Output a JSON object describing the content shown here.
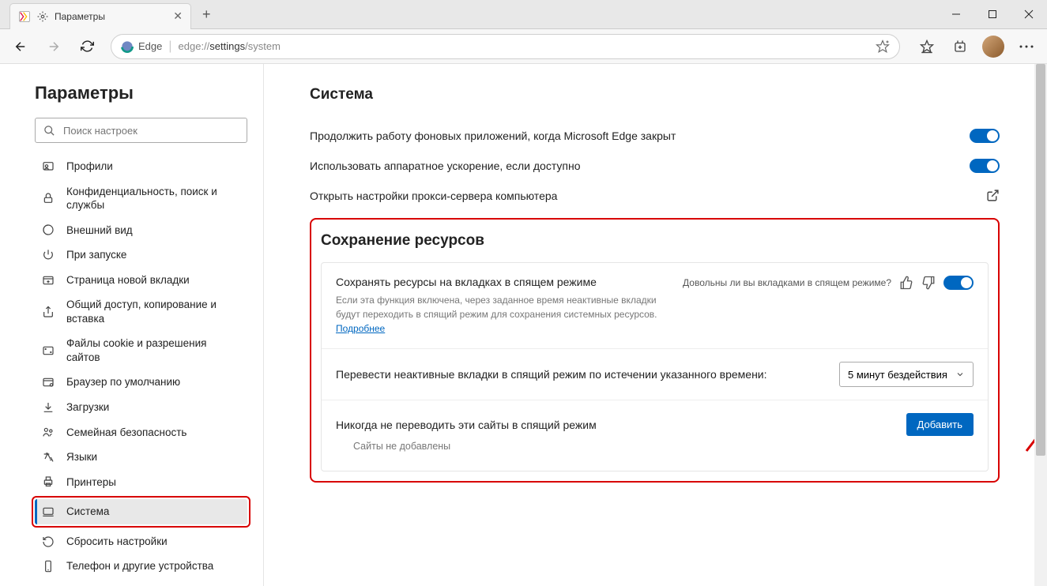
{
  "tab": {
    "title": "Параметры"
  },
  "address": {
    "scheme": "edge://",
    "path_dark": "settings",
    "path_rest": "/system",
    "edge_label": "Edge"
  },
  "sidebar": {
    "title": "Параметры",
    "search_placeholder": "Поиск настроек",
    "items": [
      {
        "label": "Профили"
      },
      {
        "label": "Конфиденциальность, поиск и службы"
      },
      {
        "label": "Внешний вид"
      },
      {
        "label": "При запуске"
      },
      {
        "label": "Страница новой вкладки"
      },
      {
        "label": "Общий доступ, копирование и вставка"
      },
      {
        "label": "Файлы cookie и разрешения сайтов"
      },
      {
        "label": "Браузер по умолчанию"
      },
      {
        "label": "Загрузки"
      },
      {
        "label": "Семейная безопасность"
      },
      {
        "label": "Языки"
      },
      {
        "label": "Принтеры"
      },
      {
        "label": "Система"
      },
      {
        "label": "Сбросить настройки"
      },
      {
        "label": "Телефон и другие устройства"
      }
    ]
  },
  "content": {
    "section1_title": "Система",
    "row1": "Продолжить работу фоновых приложений, когда Microsoft Edge закрыт",
    "row2": "Использовать аппаратное ускорение, если доступно",
    "row3": "Открыть настройки прокси-сервера компьютера",
    "section2_title": "Сохранение ресурсов",
    "sleep_card": {
      "title": "Сохранять ресурсы на вкладках в спящем режиме",
      "desc": "Если эта функция включена, через заданное время неактивные вкладки будут переходить в спящий режим для сохранения системных ресурсов. ",
      "link": "Подробнее",
      "feedback_q": "Довольны ли вы вкладками в спящем режиме?",
      "timeout_label": "Перевести неактивные вкладки в спящий режим по истечении указанного времени:",
      "timeout_value": "5 минут бездействия",
      "never_label": "Никогда не переводить эти сайты в спящий режим",
      "add_btn": "Добавить",
      "empty": "Сайты не добавлены"
    }
  }
}
